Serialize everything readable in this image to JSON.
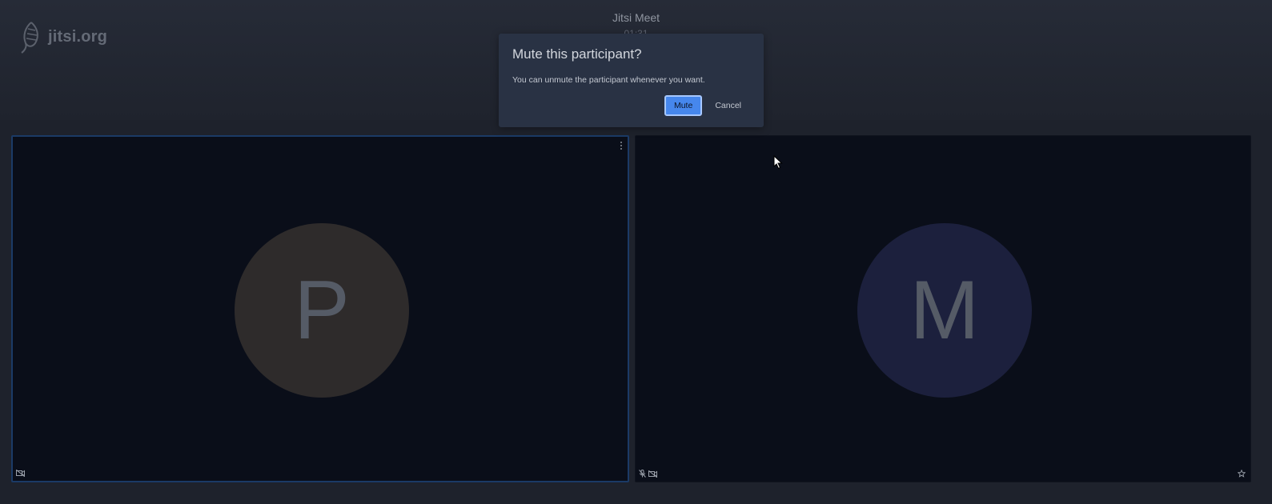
{
  "header": {
    "logo_text": "jitsi.org",
    "title": "Jitsi Meet",
    "timer": "01:31"
  },
  "tiles": [
    {
      "initial": "P",
      "avatar_color": "#2e2b2b",
      "active": true
    },
    {
      "initial": "M",
      "avatar_color": "#1c203d",
      "active": false
    }
  ],
  "dialog": {
    "title": "Mute this participant?",
    "body": "You can unmute the participant whenever you want.",
    "confirm_label": "Mute",
    "cancel_label": "Cancel"
  },
  "icons": {
    "left_tile_status": [
      "video-off-icon"
    ],
    "right_tile_status": [
      "mic-off-icon",
      "video-off-icon"
    ],
    "right_tile_indicator": "star-icon",
    "tile_menu": "more-vertical-icon"
  },
  "colors": {
    "accent": "#4687ed",
    "active_border": "#1b3a66",
    "dialog_bg": "#293244"
  }
}
